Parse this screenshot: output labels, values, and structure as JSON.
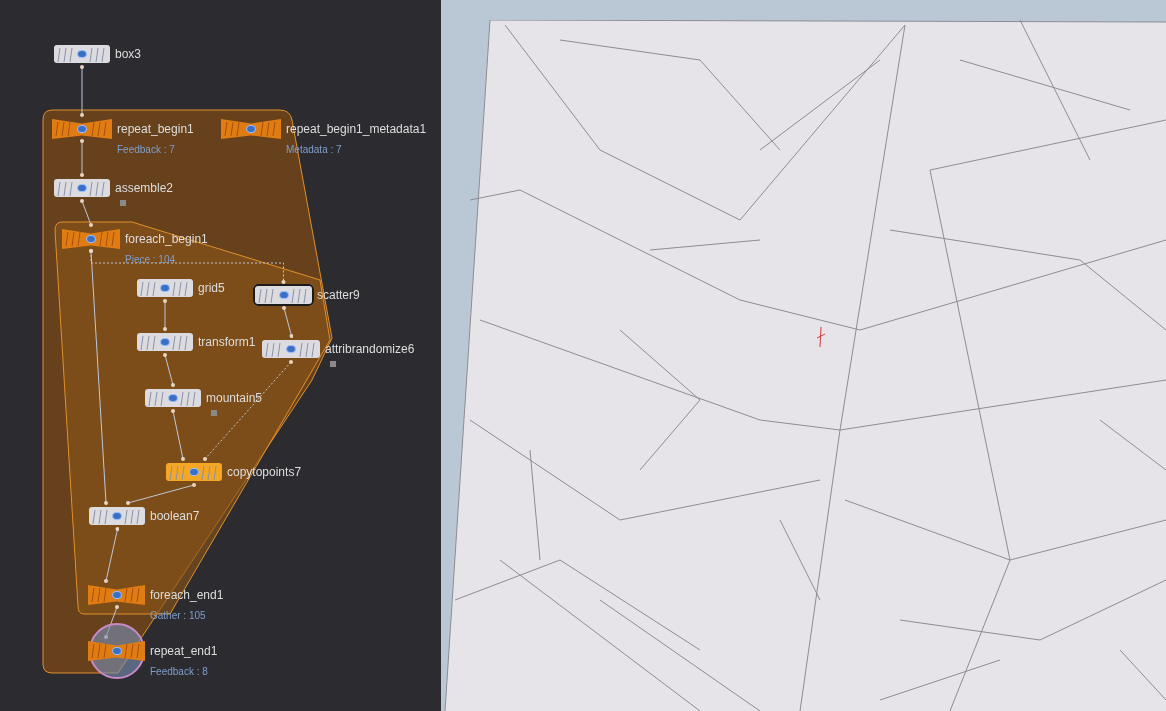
{
  "network_editor": {
    "nodes": [
      {
        "kind": "sop",
        "label": "box3",
        "color": "#dcdce0",
        "selected": false,
        "display": false
      },
      {
        "kind": "block",
        "label": "repeat_begin1",
        "info": "Feedback : 7",
        "color": "#e07c14",
        "selected": false,
        "display": false
      },
      {
        "kind": "block",
        "label": "repeat_begin1_metadata1",
        "info": "Metadata : 7",
        "color": "#e07c14",
        "selected": false,
        "display": false
      },
      {
        "kind": "sop",
        "label": "assemble2",
        "color": "#dcdce0",
        "selected": false,
        "display": false
      },
      {
        "kind": "block",
        "label": "foreach_begin1",
        "info": "Piece : 104",
        "color": "#e07c14",
        "selected": false,
        "display": false
      },
      {
        "kind": "sop",
        "label": "grid5",
        "color": "#dcdce0",
        "selected": false,
        "display": false
      },
      {
        "kind": "sop",
        "label": "scatter9",
        "color": "#dcdce0",
        "selected": true,
        "display": false
      },
      {
        "kind": "sop",
        "label": "transform1",
        "color": "#dcdce0",
        "selected": false,
        "display": false
      },
      {
        "kind": "sop",
        "label": "attribrandomize6",
        "color": "#dcdce0",
        "selected": false,
        "display": false
      },
      {
        "kind": "sop",
        "label": "mountain5",
        "color": "#dcdce0",
        "selected": false,
        "display": false
      },
      {
        "kind": "sop",
        "label": "copytopoints7",
        "color": "#f5a623",
        "selected": false,
        "display": false
      },
      {
        "kind": "sop",
        "label": "boolean7",
        "color": "#dcdce0",
        "selected": false,
        "display": false
      },
      {
        "kind": "block",
        "label": "foreach_end1",
        "info": "Gather : 105",
        "color": "#e07c14",
        "selected": false,
        "display": false
      },
      {
        "kind": "block",
        "label": "repeat_end1",
        "info": "Feedback : 8",
        "color": "#e07c14",
        "selected": false,
        "display": true
      }
    ]
  }
}
